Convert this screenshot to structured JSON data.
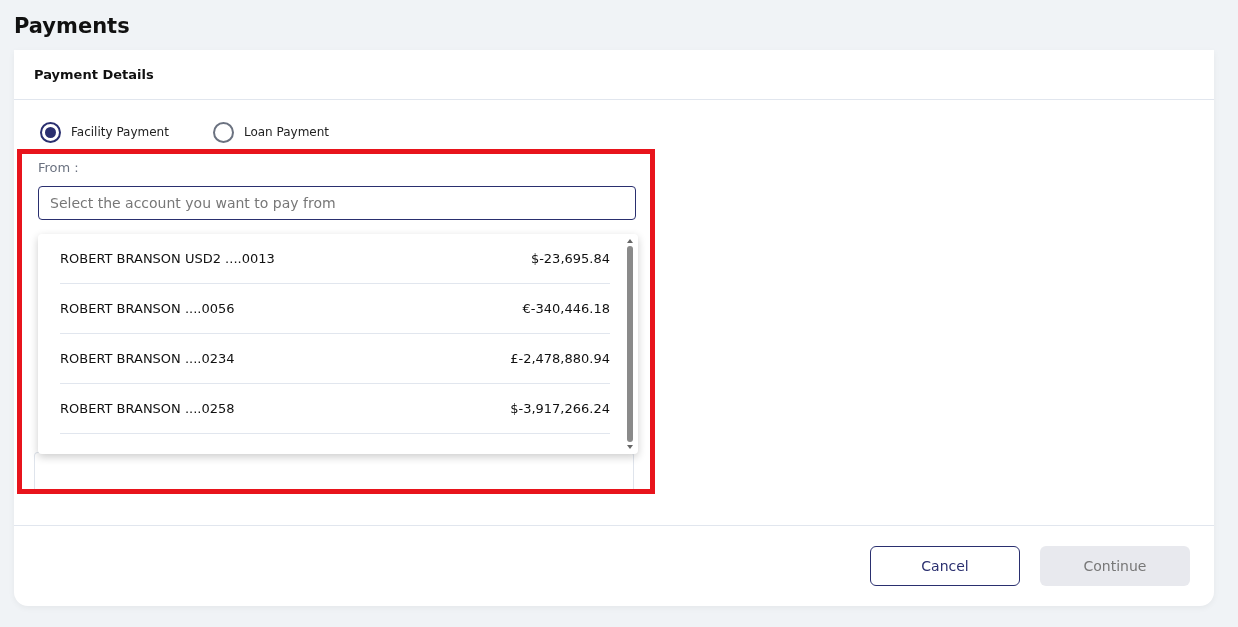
{
  "page_title": "Payments",
  "card": {
    "title": "Payment Details"
  },
  "payment_types": [
    {
      "label": "Facility Payment",
      "selected": true
    },
    {
      "label": "Loan Payment",
      "selected": false
    }
  ],
  "from_field": {
    "label": "From :",
    "placeholder": "Select the account you want to pay from"
  },
  "accounts": [
    {
      "name": "ROBERT BRANSON USD2 ....0013",
      "balance": "$-23,695.84"
    },
    {
      "name": "ROBERT BRANSON ....0056",
      "balance": "€-340,446.18"
    },
    {
      "name": "ROBERT BRANSON ....0234",
      "balance": "£-2,478,880.94"
    },
    {
      "name": "ROBERT BRANSON ....0258",
      "balance": "$-3,917,266.24"
    }
  ],
  "buttons": [
    {
      "label": "Cancel",
      "kind": "secondary",
      "disabled": false
    },
    {
      "label": "Continue",
      "kind": "primary",
      "disabled": true
    }
  ]
}
